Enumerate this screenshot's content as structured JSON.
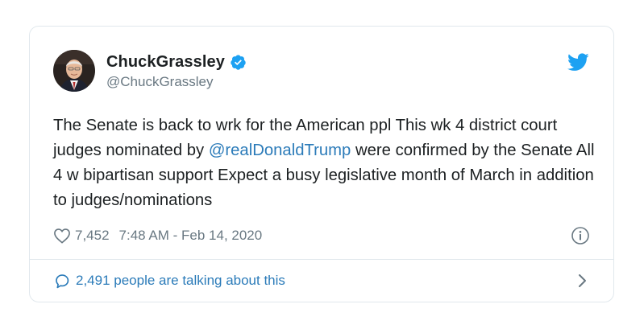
{
  "author": {
    "display_name": "ChuckGrassley",
    "handle": "@ChuckGrassley",
    "verified": true
  },
  "tweet": {
    "text_part1": "The Senate is back to wrk for the American ppl This wk 4 district court judges nominated by ",
    "mention": "@realDonaldTrump",
    "text_part2": " were confirmed by the Senate All 4 w bipartisan support Expect a busy legislative month of March in addition to judges/nominations"
  },
  "meta": {
    "like_count": "7,452",
    "timestamp": "7:48 AM - Feb 14, 2020"
  },
  "footer": {
    "conversation_label": "2,491 people are talking about this"
  },
  "icons": {
    "logo": "twitter-bird-icon",
    "verified": "verified-badge-icon",
    "like": "heart-icon",
    "info": "info-icon",
    "reply": "speech-bubble-icon",
    "more": "chevron-right-icon"
  },
  "colors": {
    "brand": "#1da1f2",
    "link": "#2b7bb9",
    "text": "#1c2022",
    "secondary": "#697882",
    "border": "#e1e8ed"
  }
}
